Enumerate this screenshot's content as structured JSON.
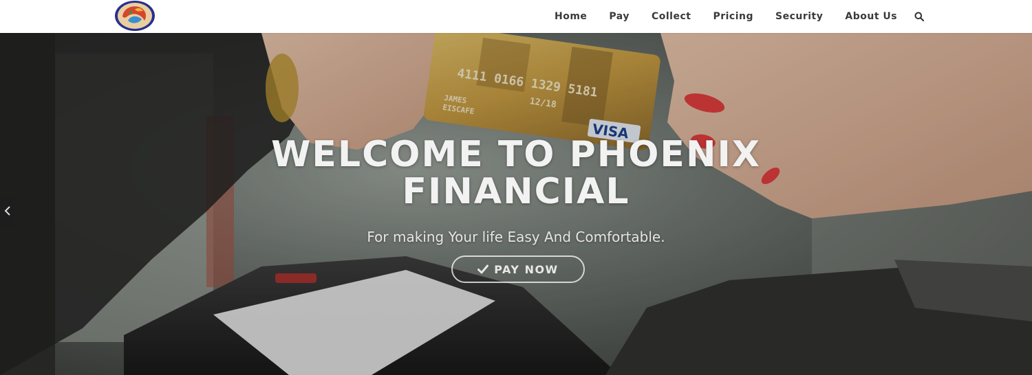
{
  "navbar": {
    "logo_icon": "phoenix-logo-icon",
    "items": [
      {
        "label": "Home"
      },
      {
        "label": "Pay"
      },
      {
        "label": "Collect"
      },
      {
        "label": "Pricing"
      },
      {
        "label": "Security"
      },
      {
        "label": "About Us"
      }
    ],
    "search_icon": "search-icon"
  },
  "hero": {
    "title_line1": "WELCOME TO PHOENIX",
    "title_line2": "FINANCIAL",
    "subtitle": "For making Your life Easy And Comfortable.",
    "cta_label": "PAY NOW",
    "cta_icon": "check-icon",
    "prev_arrow_icon": "chevron-left-icon",
    "card": {
      "number": "4111 0166 1329 5181",
      "brand": "VISA",
      "holder_line1": "JAMES",
      "holder_line2": "EISCAFE",
      "expiry": "12/18"
    }
  },
  "colors": {
    "navbar_bg": "#ffffff",
    "nav_text": "#3a3a3a",
    "hero_text": "#f2f2f2",
    "card_gold": "#c9a24a",
    "nail_red": "#e03a3a"
  }
}
